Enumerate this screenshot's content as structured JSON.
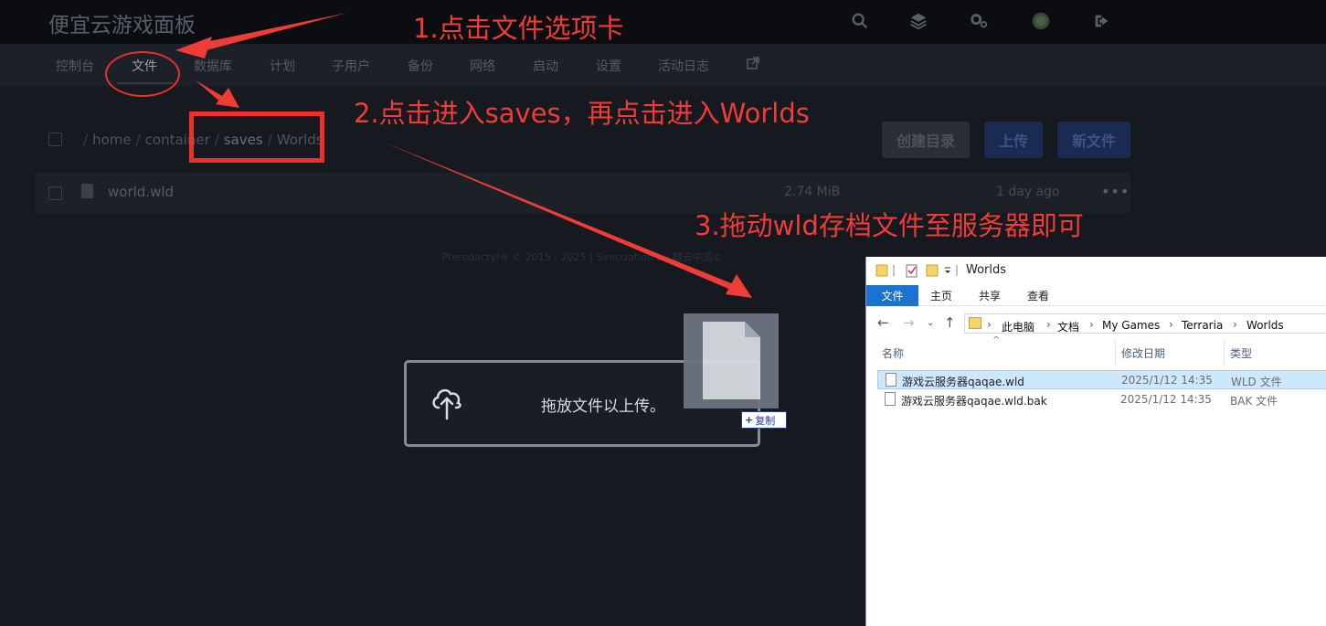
{
  "app": {
    "brand": "便宜云游戏面板"
  },
  "nav": {
    "items": [
      "控制台",
      "文件",
      "数据库",
      "计划",
      "子用户",
      "备份",
      "网络",
      "启动",
      "设置",
      "活动日志"
    ],
    "active_index": 1,
    "external_icon": "external-link-icon"
  },
  "header_icons": [
    "search-icon",
    "layers-icon",
    "settings-icon",
    "avatar",
    "logout-icon"
  ],
  "breadcrumb": {
    "parts": [
      "home",
      "container",
      "saves",
      "Worlds"
    ]
  },
  "actions": {
    "create_dir": "创建目录",
    "upload": "上传",
    "new_file": "新文件"
  },
  "files": [
    {
      "name": "world.wld",
      "size": "2.74 MiB",
      "modified": "1 day ago"
    }
  ],
  "footer": "Pterodactyl® © 2015 - 2025 | Sinicization by 翻云中国©",
  "dropzone": {
    "label": "拖放文件以上传。",
    "icon": "upload-cloud-icon"
  },
  "drag": {
    "badge_label": "复制"
  },
  "annotations": {
    "step1": "1.点击文件选项卡",
    "step2": "2.点击进入saves，再点击进入Worlds",
    "step3": "3.拖动wld存档文件至服务器即可",
    "color": "#f03c36"
  },
  "explorer": {
    "title": "Worlds",
    "ribbon_tabs": [
      "文件",
      "主页",
      "共享",
      "查看"
    ],
    "path": [
      "此电脑",
      "文档",
      "My Games",
      "Terraria",
      "Worlds"
    ],
    "columns": [
      "名称",
      "修改日期",
      "类型"
    ],
    "rows": [
      {
        "name": "游戏云服务器qaqae.wld",
        "date": "2025/1/12 14:35",
        "type": "WLD 文件",
        "selected": true
      },
      {
        "name": "游戏云服务器qaqae.wld.bak",
        "date": "2025/1/12 14:35",
        "type": "BAK 文件",
        "selected": false
      }
    ]
  }
}
